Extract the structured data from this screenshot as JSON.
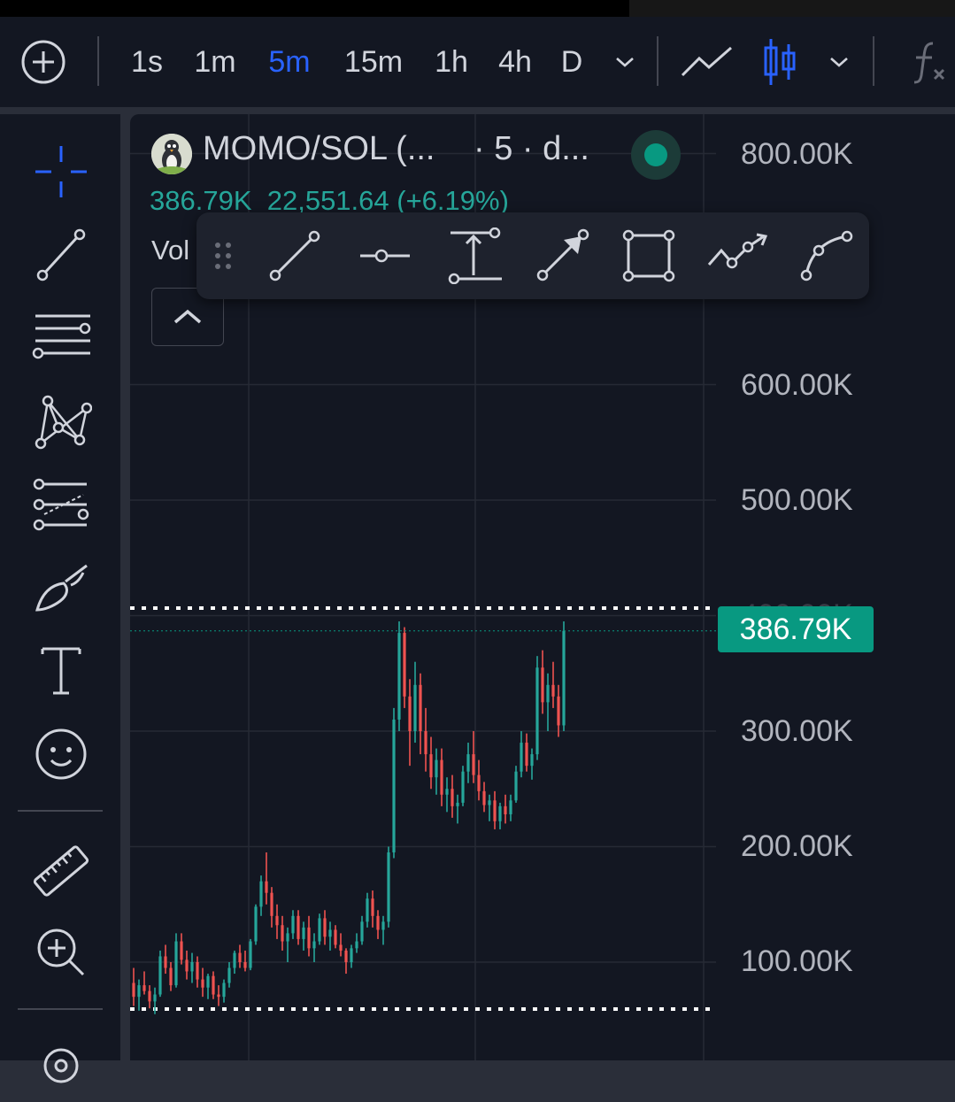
{
  "toolbar": {
    "intervals": [
      {
        "label": "1s",
        "active": false
      },
      {
        "label": "1m",
        "active": false
      },
      {
        "label": "5m",
        "active": true
      },
      {
        "label": "15m",
        "active": false
      },
      {
        "label": "1h",
        "active": false
      },
      {
        "label": "4h",
        "active": false
      },
      {
        "label": "D",
        "active": false
      }
    ],
    "icons": [
      "add-circle-icon",
      "chevron-down-icon",
      "line-chart-icon",
      "candles-icon",
      "chevron-down-icon",
      "indicators-icon"
    ]
  },
  "left_tools": [
    "crosshair-icon",
    "trend-line-icon",
    "fib-retracement-icon",
    "pattern-icon",
    "prediction-icon",
    "brush-icon",
    "text-icon",
    "emoji-icon",
    "ruler-icon",
    "zoom-in-icon",
    "magnet-icon"
  ],
  "legend": {
    "symbol": "MOMO/SOL (...",
    "interval": "· 5 · d...",
    "price": "386.79K",
    "change": "22,551.64 (+6.19%)",
    "volume_label": "Vol",
    "status": "live"
  },
  "drawing_toolbar": [
    "drag-handle-icon",
    "trend-line-icon",
    "horizontal-ray-icon",
    "vertical-measure-icon",
    "arrow-line-icon",
    "rectangle-icon",
    "path-icon",
    "curve-icon"
  ],
  "price_axis": {
    "labels": [
      "800.00K",
      "600.00K",
      "500.00K",
      "300.00K",
      "200.00K",
      "100.00K"
    ],
    "hidden_label": "400.00K",
    "current_price": "386.79K"
  },
  "chart_data": {
    "type": "candlestick",
    "symbol": "MOMO/SOL",
    "interval": "5m",
    "ylim": [
      60000,
      820000
    ],
    "last_price": 386790,
    "colors": {
      "up": "#26a69a",
      "down": "#ef5350",
      "current_price": "#089981",
      "accent": "#2962ff"
    },
    "ohlc": [
      [
        82000,
        95000,
        62000,
        70000
      ],
      [
        70000,
        85000,
        58000,
        80000
      ],
      [
        80000,
        92000,
        72000,
        75000
      ],
      [
        75000,
        80000,
        60000,
        66000
      ],
      [
        66000,
        78000,
        55000,
        72000
      ],
      [
        72000,
        110000,
        70000,
        105000
      ],
      [
        105000,
        115000,
        90000,
        95000
      ],
      [
        95000,
        100000,
        75000,
        80000
      ],
      [
        80000,
        125000,
        78000,
        118000
      ],
      [
        118000,
        125000,
        98000,
        102000
      ],
      [
        102000,
        110000,
        85000,
        92000
      ],
      [
        92000,
        108000,
        82000,
        100000
      ],
      [
        100000,
        105000,
        78000,
        85000
      ],
      [
        85000,
        95000,
        70000,
        78000
      ],
      [
        78000,
        90000,
        68000,
        88000
      ],
      [
        88000,
        92000,
        68000,
        72000
      ],
      [
        72000,
        80000,
        62000,
        70000
      ],
      [
        70000,
        85000,
        65000,
        82000
      ],
      [
        82000,
        100000,
        78000,
        95000
      ],
      [
        95000,
        110000,
        90000,
        108000
      ],
      [
        108000,
        115000,
        95000,
        100000
      ],
      [
        100000,
        110000,
        92000,
        95000
      ],
      [
        95000,
        120000,
        93000,
        118000
      ],
      [
        118000,
        150000,
        115000,
        148000
      ],
      [
        148000,
        175000,
        140000,
        170000
      ],
      [
        170000,
        195000,
        150000,
        160000
      ],
      [
        160000,
        165000,
        130000,
        140000
      ],
      [
        140000,
        150000,
        120000,
        132000
      ],
      [
        132000,
        140000,
        110000,
        118000
      ],
      [
        118000,
        130000,
        100000,
        125000
      ],
      [
        125000,
        145000,
        120000,
        140000
      ],
      [
        140000,
        145000,
        115000,
        120000
      ],
      [
        120000,
        135000,
        110000,
        130000
      ],
      [
        130000,
        140000,
        105000,
        112000
      ],
      [
        112000,
        125000,
        100000,
        118000
      ],
      [
        118000,
        142000,
        115000,
        138000
      ],
      [
        138000,
        145000,
        115000,
        122000
      ],
      [
        122000,
        135000,
        110000,
        128000
      ],
      [
        128000,
        132000,
        112000,
        115000
      ],
      [
        115000,
        125000,
        105000,
        110000
      ],
      [
        110000,
        112000,
        90000,
        100000
      ],
      [
        100000,
        115000,
        95000,
        112000
      ],
      [
        112000,
        125000,
        108000,
        118000
      ],
      [
        118000,
        140000,
        115000,
        135000
      ],
      [
        135000,
        160000,
        130000,
        155000
      ],
      [
        155000,
        162000,
        130000,
        140000
      ],
      [
        140000,
        145000,
        120000,
        128000
      ],
      [
        128000,
        140000,
        115000,
        135000
      ],
      [
        135000,
        200000,
        130000,
        195000
      ],
      [
        195000,
        320000,
        190000,
        310000
      ],
      [
        310000,
        395000,
        300000,
        385000
      ],
      [
        385000,
        390000,
        320000,
        330000
      ],
      [
        330000,
        345000,
        270000,
        300000
      ],
      [
        300000,
        360000,
        290000,
        340000
      ],
      [
        340000,
        350000,
        280000,
        300000
      ],
      [
        300000,
        320000,
        265000,
        280000
      ],
      [
        280000,
        295000,
        250000,
        260000
      ],
      [
        260000,
        285000,
        245000,
        275000
      ],
      [
        275000,
        285000,
        235000,
        245000
      ],
      [
        245000,
        260000,
        230000,
        250000
      ],
      [
        250000,
        262000,
        225000,
        235000
      ],
      [
        235000,
        245000,
        220000,
        238000
      ],
      [
        238000,
        270000,
        235000,
        265000
      ],
      [
        265000,
        290000,
        255000,
        280000
      ],
      [
        280000,
        300000,
        255000,
        262000
      ],
      [
        262000,
        275000,
        240000,
        248000
      ],
      [
        248000,
        256000,
        230000,
        236000
      ],
      [
        236000,
        245000,
        222000,
        240000
      ],
      [
        240000,
        248000,
        215000,
        222000
      ],
      [
        222000,
        238000,
        215000,
        235000
      ],
      [
        235000,
        245000,
        220000,
        228000
      ],
      [
        228000,
        245000,
        222000,
        240000
      ],
      [
        240000,
        270000,
        238000,
        265000
      ],
      [
        265000,
        300000,
        260000,
        290000
      ],
      [
        290000,
        298000,
        265000,
        270000
      ],
      [
        270000,
        285000,
        258000,
        280000
      ],
      [
        280000,
        365000,
        275000,
        355000
      ],
      [
        355000,
        370000,
        315000,
        325000
      ],
      [
        325000,
        350000,
        300000,
        340000
      ],
      [
        340000,
        360000,
        320000,
        330000
      ],
      [
        330000,
        340000,
        295000,
        305000
      ],
      [
        305000,
        395000,
        300000,
        386790
      ]
    ]
  }
}
